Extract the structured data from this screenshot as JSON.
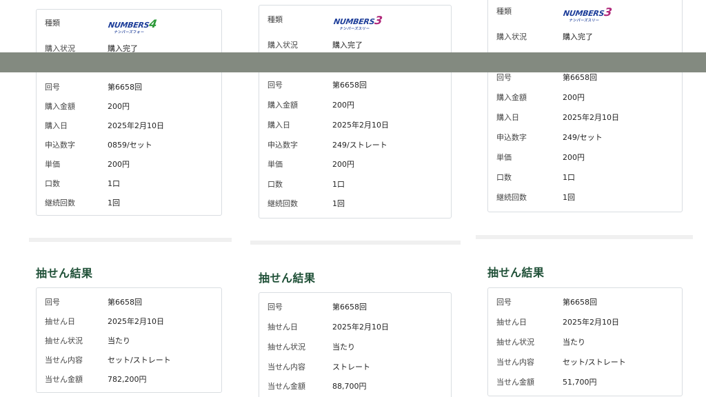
{
  "colors": {
    "title_green": "#1f5037",
    "logo_blue": "#1f3f9a",
    "logo_green_4": "#2e9a3a",
    "logo_magenta_3": "#b0287a",
    "overlay": "#838a80",
    "card_border": "#d9dde1"
  },
  "labels": {
    "type": "種類",
    "status": "購入状況",
    "round": "回号",
    "amount": "購入金額",
    "date": "購入日",
    "numbers": "申込数字",
    "unit_price": "単価",
    "count": "口数",
    "continue": "継続回数",
    "section_title": "抽せん結果",
    "draw_round": "回号",
    "draw_date": "抽せん日",
    "draw_status": "抽せん状況",
    "win_detail": "当せん内容",
    "win_amount": "当せん金額"
  },
  "columns": [
    {
      "logo": {
        "word": "NUMBERS",
        "digit": "4",
        "sub": "ナンバーズフォー"
      },
      "purchase": {
        "status": "購入完了",
        "round": "第6658回",
        "amount": "200円",
        "date": "2025年2月10日",
        "numbers": "0859/セット",
        "unit_price": "200円",
        "count": "1口",
        "continue": "1回"
      },
      "result": {
        "round": "第6658回",
        "date": "2025年2月10日",
        "status": "当たり",
        "detail": "セット/ストレート",
        "amount": "782,200円"
      }
    },
    {
      "logo": {
        "word": "NUMBERS",
        "digit": "3",
        "sub": "ナンバーズスリー"
      },
      "purchase": {
        "status": "購入完了",
        "round": "第6658回",
        "amount": "200円",
        "date": "2025年2月10日",
        "numbers": "249/ストレート",
        "unit_price": "200円",
        "count": "1口",
        "continue": "1回"
      },
      "result": {
        "round": "第6658回",
        "date": "2025年2月10日",
        "status": "当たり",
        "detail": "ストレート",
        "amount": "88,700円"
      }
    },
    {
      "logo": {
        "word": "NUMBERS",
        "digit": "3",
        "sub": "ナンバーズスリー"
      },
      "purchase": {
        "status": "購入完了",
        "round": "第6658回",
        "amount": "200円",
        "date": "2025年2月10日",
        "numbers": "249/セット",
        "unit_price": "200円",
        "count": "1口",
        "continue": "1回"
      },
      "result": {
        "round": "第6658回",
        "date": "2025年2月10日",
        "status": "当たり",
        "detail": "セット/ストレート",
        "amount": "51,700円"
      }
    }
  ]
}
